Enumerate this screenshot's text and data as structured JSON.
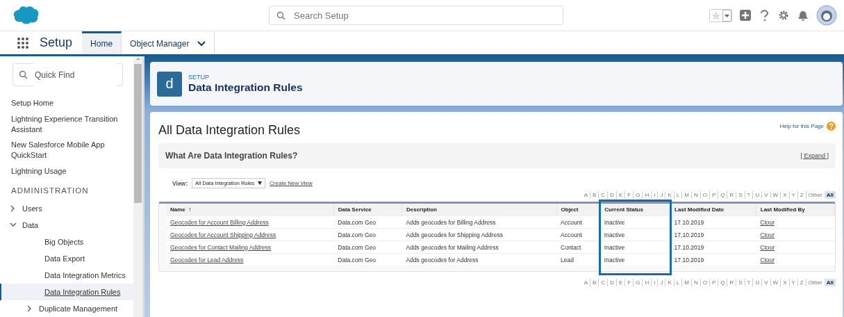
{
  "header": {
    "search": {
      "placeholder": "Search Setup"
    }
  },
  "nav": {
    "app_name": "Setup",
    "tabs": [
      {
        "label": "Home",
        "selected": true,
        "kind": "plain"
      },
      {
        "label": "Object Manager",
        "selected": false,
        "kind": "menu"
      }
    ]
  },
  "sidebar": {
    "search": {
      "placeholder": "Quick Find"
    },
    "items": [
      {
        "label": "Setup Home",
        "kind": "link",
        "selected": false
      },
      {
        "label": "Lightning Experience Transition Assistant",
        "kind": "link",
        "selected": false
      },
      {
        "label": "New Salesforce Mobile App QuickStart",
        "kind": "link",
        "selected": false
      },
      {
        "label": "Lightning Usage",
        "kind": "link",
        "selected": false
      },
      {
        "label": "ADMINISTRATION",
        "kind": "heading",
        "selected": false
      },
      {
        "label": "Users",
        "kind": "folder",
        "expanded": false,
        "selected": false
      },
      {
        "label": "Data",
        "kind": "folder",
        "expanded": true,
        "selected": false,
        "children": [
          {
            "label": "Big Objects",
            "kind": "link",
            "selected": false
          },
          {
            "label": "Data Export",
            "kind": "link",
            "selected": false
          },
          {
            "label": "Data Integration Metrics",
            "kind": "link",
            "selected": false
          },
          {
            "label": "Data Integration Rules",
            "kind": "link",
            "selected": true
          },
          {
            "label": "Duplicate Management",
            "kind": "folder",
            "expanded": false,
            "selected": false
          }
        ]
      }
    ]
  },
  "page_header": {
    "icon_letter": "d",
    "eyebrow": "SETUP",
    "title": "Data Integration Rules"
  },
  "content": {
    "title": "All Data Integration Rules",
    "help_link": "Help for this Page",
    "info_box": {
      "title": "What Are Data Integration Rules?",
      "toggle": "[ Expand ]"
    },
    "view": {
      "label": "View:",
      "value": "All Data Integration Rules",
      "create_link": "Create New View"
    },
    "alphabet_top": [
      {
        "label": "A",
        "selected": false
      },
      {
        "label": "B",
        "selected": false
      },
      {
        "label": "C",
        "selected": false
      },
      {
        "label": "D",
        "selected": false
      },
      {
        "label": "E",
        "selected": false
      },
      {
        "label": "F",
        "selected": false
      },
      {
        "label": "G",
        "selected": false
      },
      {
        "label": "H",
        "selected": false
      },
      {
        "label": "I",
        "selected": false
      },
      {
        "label": "J",
        "selected": false
      },
      {
        "label": "K",
        "selected": false
      },
      {
        "label": "L",
        "selected": false
      },
      {
        "label": "M",
        "selected": false
      },
      {
        "label": "N",
        "selected": false
      },
      {
        "label": "O",
        "selected": false
      },
      {
        "label": "P",
        "selected": false
      },
      {
        "label": "Q",
        "selected": false
      },
      {
        "label": "R",
        "selected": false
      },
      {
        "label": "S",
        "selected": false
      },
      {
        "label": "T",
        "selected": false
      },
      {
        "label": "U",
        "selected": false
      },
      {
        "label": "V",
        "selected": false
      },
      {
        "label": "W",
        "selected": false
      },
      {
        "label": "X",
        "selected": false
      },
      {
        "label": "Y",
        "selected": false
      },
      {
        "label": "Z",
        "selected": false
      },
      {
        "label": "Other",
        "selected": false
      },
      {
        "label": "All",
        "selected": true
      }
    ],
    "table": {
      "columns": [
        {
          "label": "Name",
          "sort_mark": "↑",
          "highlighted": false
        },
        {
          "label": "Data Service",
          "highlighted": false
        },
        {
          "label": "Description",
          "highlighted": false
        },
        {
          "label": "Object",
          "highlighted": false
        },
        {
          "label": "Current Status",
          "highlighted": true
        },
        {
          "label": "Last Modified Date",
          "highlighted": false
        },
        {
          "label": "Last Modified By",
          "highlighted": false
        }
      ],
      "rows": [
        [
          "Geocodes for Account Billing Address",
          "Data.com Geo",
          "Adds geocodes for Billing Address",
          "Account",
          "Inactive",
          "17.10.2019",
          "Ctour"
        ],
        [
          "Geocodes for Account Shipping Address",
          "Data.com Geo",
          "Adds geocodes for Shipping Address",
          "Account",
          "Inactive",
          "17.10.2019",
          "Ctour"
        ],
        [
          "Geocodes for Contact Mailing Address",
          "Data.com Geo",
          "Adds geocodes for Mailing Address",
          "Contact",
          "Inactive",
          "17.10.2019",
          "Ctour"
        ],
        [
          "Geocodes for Lead Address",
          "Data.com Geo",
          "Adds geocodes for Address",
          "Lead",
          "Inactive",
          "17.10.2019",
          "Ctour"
        ]
      ]
    },
    "alphabet_bottom": [
      {
        "label": "A",
        "selected": false
      },
      {
        "label": "B",
        "selected": false
      },
      {
        "label": "C",
        "selected": false
      },
      {
        "label": "D",
        "selected": false
      },
      {
        "label": "E",
        "selected": false
      },
      {
        "label": "F",
        "selected": false
      },
      {
        "label": "G",
        "selected": false
      },
      {
        "label": "H",
        "selected": false
      },
      {
        "label": "I",
        "selected": false
      },
      {
        "label": "J",
        "selected": false
      },
      {
        "label": "K",
        "selected": false
      },
      {
        "label": "L",
        "selected": false
      },
      {
        "label": "M",
        "selected": false
      },
      {
        "label": "N",
        "selected": false
      },
      {
        "label": "O",
        "selected": false
      },
      {
        "label": "P",
        "selected": false
      },
      {
        "label": "Q",
        "selected": false
      },
      {
        "label": "R",
        "selected": false
      },
      {
        "label": "S",
        "selected": false
      },
      {
        "label": "T",
        "selected": false
      },
      {
        "label": "U",
        "selected": false
      },
      {
        "label": "V",
        "selected": false
      },
      {
        "label": "W",
        "selected": false
      },
      {
        "label": "X",
        "selected": false
      },
      {
        "label": "Y",
        "selected": false
      },
      {
        "label": "Z",
        "selected": false
      },
      {
        "label": "Other",
        "selected": false
      },
      {
        "label": "All",
        "selected": true
      }
    ]
  }
}
